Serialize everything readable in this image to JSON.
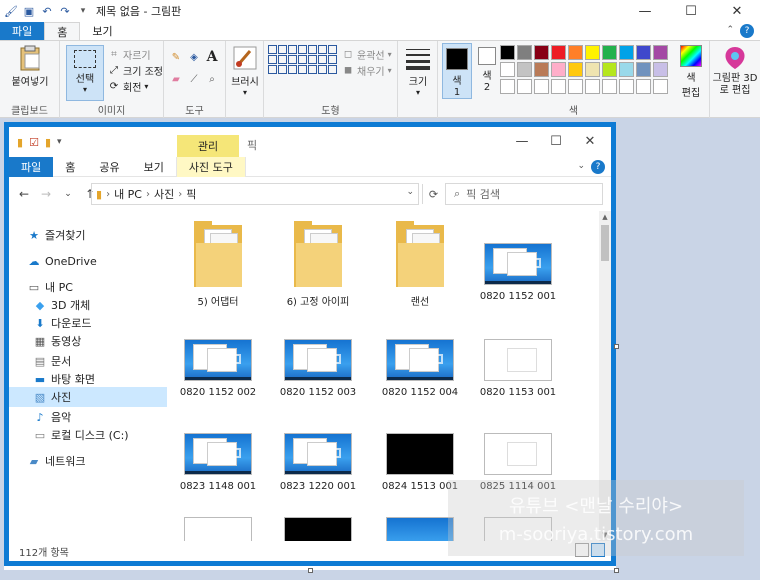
{
  "paint": {
    "title": "제목 없음 - 그림판",
    "tabs": [
      "파일",
      "홈",
      "보기"
    ],
    "groups": {
      "clipboard": {
        "label": "클립보드",
        "paste": "붙여넣기"
      },
      "image": {
        "label": "이미지",
        "select": "선택",
        "crop": "자르기",
        "resize": "크기 조정",
        "rotate": "회전"
      },
      "tools": {
        "label": "도구"
      },
      "brushes": {
        "label": "브러시"
      },
      "shapes": {
        "label": "도형",
        "outline": "윤곽선",
        "fill": "채우기"
      },
      "size": {
        "label": "크기"
      },
      "colors": {
        "label": "색",
        "color1": "색\n1",
        "color2": "색\n2",
        "edit": "색\n편집",
        "palette": [
          "#000000",
          "#7f7f7f",
          "#880015",
          "#ed1c24",
          "#ff7f27",
          "#fff200",
          "#22b14c",
          "#00a2e8",
          "#3f48cc",
          "#a349a4",
          "#ffffff",
          "#c3c3c3",
          "#b97a57",
          "#ffaec9",
          "#ffc90e",
          "#efe4b0",
          "#b5e61d",
          "#99d9ea",
          "#7092be",
          "#c8bfe7",
          "#ffffff",
          "#ffffff",
          "#ffffff",
          "#ffffff",
          "#ffffff",
          "#ffffff",
          "#ffffff",
          "#ffffff",
          "#ffffff",
          "#ffffff"
        ]
      },
      "paint3d": {
        "label": "그림판 3D로 편집"
      }
    }
  },
  "explorer": {
    "title": "픽",
    "manage": "관리",
    "tabs": [
      "파일",
      "홈",
      "공유",
      "보기",
      "사진 도구"
    ],
    "breadcrumb": [
      "내 PC",
      "사진",
      "픽"
    ],
    "search_placeholder": "픽 검색",
    "sidebar": [
      {
        "label": "즐겨찾기",
        "icon": "star-icon"
      },
      {
        "label": "OneDrive",
        "icon": "cloud-icon"
      },
      {
        "label": "내 PC",
        "icon": "pc-icon"
      },
      {
        "label": "3D 개체",
        "icon": "cube-icon"
      },
      {
        "label": "다운로드",
        "icon": "download-icon"
      },
      {
        "label": "동영상",
        "icon": "film-icon"
      },
      {
        "label": "문서",
        "icon": "document-icon"
      },
      {
        "label": "바탕 화면",
        "icon": "desktop-icon"
      },
      {
        "label": "사진",
        "icon": "picture-icon"
      },
      {
        "label": "음악",
        "icon": "music-icon"
      },
      {
        "label": "로컬 디스크 (C:)",
        "icon": "drive-icon"
      },
      {
        "label": "네트워크",
        "icon": "network-icon"
      }
    ],
    "items": [
      {
        "label": "5) 어댑터",
        "type": "folder"
      },
      {
        "label": "6) 고정 아이피",
        "type": "folder"
      },
      {
        "label": "랜선",
        "type": "folder"
      },
      {
        "label": "0820 1152 001",
        "type": "shot-blue"
      },
      {
        "label": "0820 1152 002",
        "type": "shot-blue"
      },
      {
        "label": "0820 1152 003",
        "type": "shot-blue"
      },
      {
        "label": "0820 1152 004",
        "type": "shot-blue"
      },
      {
        "label": "0820 1153 001",
        "type": "shot-white"
      },
      {
        "label": "0823 1148 001",
        "type": "shot-blue"
      },
      {
        "label": "0823 1220 001",
        "type": "shot-blue"
      },
      {
        "label": "0824 1513 001",
        "type": "shot-black"
      },
      {
        "label": "0825 1114 001",
        "type": "shot-white"
      }
    ],
    "status": "112개 항목"
  },
  "watermark": {
    "line1": "유튜브 <맨날 수리야>",
    "line2": "m-sooriya.tistory.com"
  }
}
